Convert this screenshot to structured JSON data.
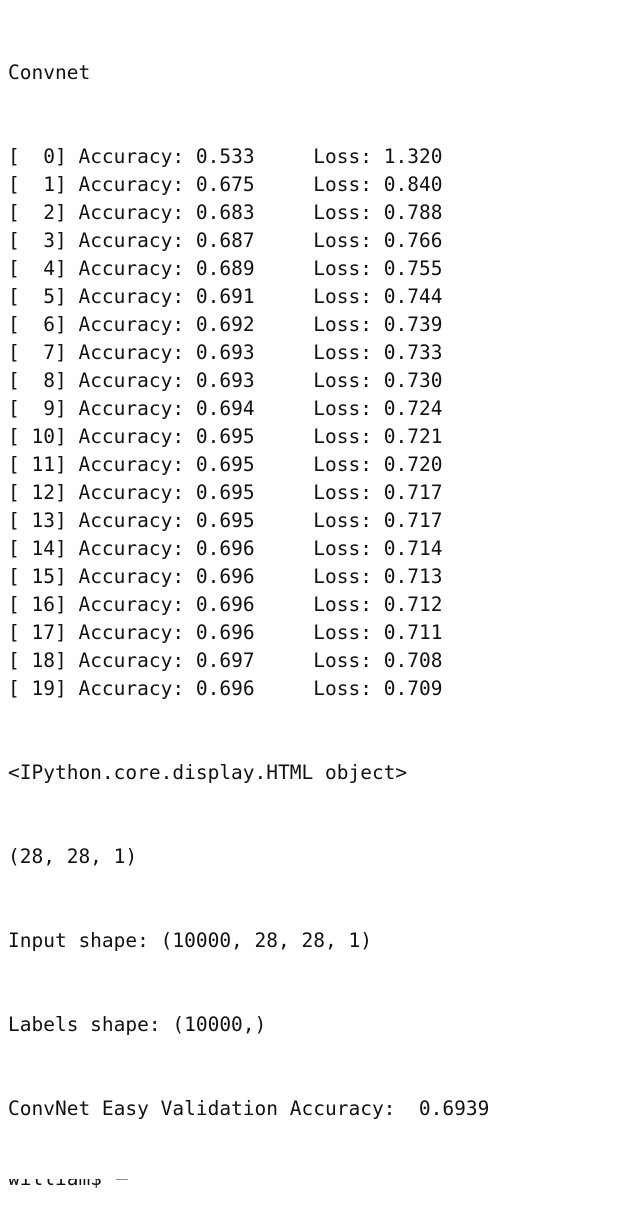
{
  "terminal": {
    "title": "Convnet",
    "epochs": [
      {
        "label": "[  0]",
        "acc_label": "Accuracy:",
        "acc": "0.533",
        "loss_label": "Loss:",
        "loss": "1.320"
      },
      {
        "label": "[  1]",
        "acc_label": "Accuracy:",
        "acc": "0.675",
        "loss_label": "Loss:",
        "loss": "0.840"
      },
      {
        "label": "[  2]",
        "acc_label": "Accuracy:",
        "acc": "0.683",
        "loss_label": "Loss:",
        "loss": "0.788"
      },
      {
        "label": "[  3]",
        "acc_label": "Accuracy:",
        "acc": "0.687",
        "loss_label": "Loss:",
        "loss": "0.766"
      },
      {
        "label": "[  4]",
        "acc_label": "Accuracy:",
        "acc": "0.689",
        "loss_label": "Loss:",
        "loss": "0.755"
      },
      {
        "label": "[  5]",
        "acc_label": "Accuracy:",
        "acc": "0.691",
        "loss_label": "Loss:",
        "loss": "0.744"
      },
      {
        "label": "[  6]",
        "acc_label": "Accuracy:",
        "acc": "0.692",
        "loss_label": "Loss:",
        "loss": "0.739"
      },
      {
        "label": "[  7]",
        "acc_label": "Accuracy:",
        "acc": "0.693",
        "loss_label": "Loss:",
        "loss": "0.733"
      },
      {
        "label": "[  8]",
        "acc_label": "Accuracy:",
        "acc": "0.693",
        "loss_label": "Loss:",
        "loss": "0.730"
      },
      {
        "label": "[  9]",
        "acc_label": "Accuracy:",
        "acc": "0.694",
        "loss_label": "Loss:",
        "loss": "0.724"
      },
      {
        "label": "[ 10]",
        "acc_label": "Accuracy:",
        "acc": "0.695",
        "loss_label": "Loss:",
        "loss": "0.721"
      },
      {
        "label": "[ 11]",
        "acc_label": "Accuracy:",
        "acc": "0.695",
        "loss_label": "Loss:",
        "loss": "0.720"
      },
      {
        "label": "[ 12]",
        "acc_label": "Accuracy:",
        "acc": "0.695",
        "loss_label": "Loss:",
        "loss": "0.717"
      },
      {
        "label": "[ 13]",
        "acc_label": "Accuracy:",
        "acc": "0.695",
        "loss_label": "Loss:",
        "loss": "0.717"
      },
      {
        "label": "[ 14]",
        "acc_label": "Accuracy:",
        "acc": "0.696",
        "loss_label": "Loss:",
        "loss": "0.714"
      },
      {
        "label": "[ 15]",
        "acc_label": "Accuracy:",
        "acc": "0.696",
        "loss_label": "Loss:",
        "loss": "0.713"
      },
      {
        "label": "[ 16]",
        "acc_label": "Accuracy:",
        "acc": "0.696",
        "loss_label": "Loss:",
        "loss": "0.712"
      },
      {
        "label": "[ 17]",
        "acc_label": "Accuracy:",
        "acc": "0.696",
        "loss_label": "Loss:",
        "loss": "0.711"
      },
      {
        "label": "[ 18]",
        "acc_label": "Accuracy:",
        "acc": "0.697",
        "loss_label": "Loss:",
        "loss": "0.708"
      },
      {
        "label": "[ 19]",
        "acc_label": "Accuracy:",
        "acc": "0.696",
        "loss_label": "Loss:",
        "loss": "0.709"
      }
    ],
    "display_object": "<IPython.core.display.HTML object>",
    "sample_shape": "(28, 28, 1)",
    "input_shape": "Input shape: (10000, 28, 28, 1)",
    "labels_shape": "Labels shape: (10000,)",
    "validation": "ConvNet Easy Validation Accuracy:  0.6939",
    "prompt_partial": "william$ "
  }
}
